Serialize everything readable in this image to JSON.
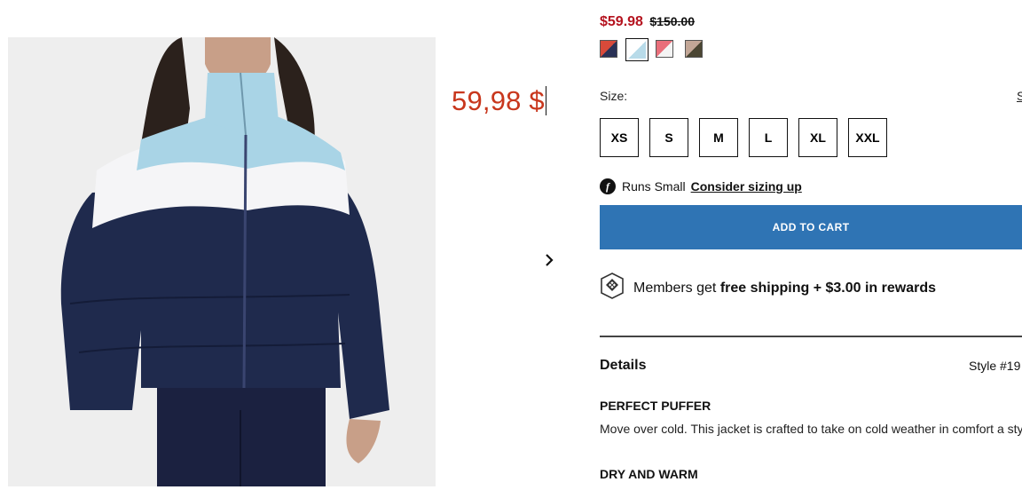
{
  "price": {
    "sale": "$59.98",
    "original": "$150.00",
    "overlay_text": "59,98 $"
  },
  "swatches": [
    {
      "name": "Navy / Red",
      "colors": [
        "#2a3156",
        "#d84a3a"
      ],
      "selected": false
    },
    {
      "name": "Navy / Light Blue",
      "colors": [
        "#b8dbe9",
        "#ffffff"
      ],
      "selected": true
    },
    {
      "name": "Pink / White",
      "colors": [
        "#f4f4f4",
        "#e96e7a"
      ],
      "selected": false
    },
    {
      "name": "Olive / Tan",
      "colors": [
        "#4b4633",
        "#c3a797"
      ],
      "selected": false
    }
  ],
  "size": {
    "label": "Size:",
    "guide_link": "S",
    "options": [
      "XS",
      "S",
      "M",
      "L",
      "XL",
      "XXL"
    ]
  },
  "fit": {
    "icon": "f",
    "text": "Runs Small",
    "link": "Consider sizing up"
  },
  "cart": {
    "button_label": "ADD TO CART",
    "accent": "#2f74b4"
  },
  "members": {
    "prefix": "Members get ",
    "bold": "free shipping + $3.00 in rewards"
  },
  "details": {
    "heading": "Details",
    "style_number": "Style #19",
    "section1_title": "PERFECT PUFFER",
    "section1_body": "Move over cold. This jacket is crafted to take on cold weather in comfort a style.",
    "section2_title": "DRY AND WARM"
  },
  "image": {
    "jacket_colors": [
      "#1f2a4d",
      "#f5f5f7",
      "#a9d4e6"
    ]
  }
}
